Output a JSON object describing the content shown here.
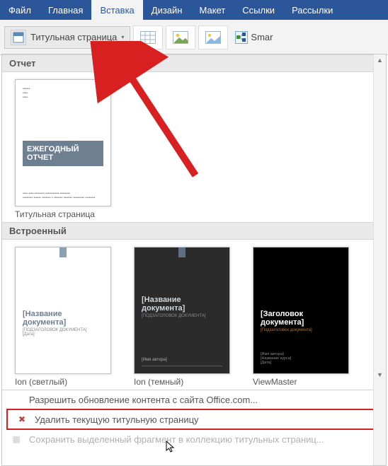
{
  "tabs": {
    "file": "Файл",
    "home": "Главная",
    "insert": "Вставка",
    "design": "Дизайн",
    "layout": "Макет",
    "references": "Ссылки",
    "mailings": "Рассылки"
  },
  "ribbon": {
    "title_page": "Титульная страница",
    "smart": "Smar"
  },
  "gallery": {
    "section_report": "Отчет",
    "report_item_label": "Титульная страница",
    "report_thumb": {
      "line1": "ЕЖЕГОДНЫЙ",
      "line2": "ОТЧЕТ",
      "sub": "ФГ [Год]"
    },
    "section_builtin": "Встроенный",
    "items": [
      {
        "label": "Ion (светлый)",
        "title": "[Название документа]",
        "style": "ion-light"
      },
      {
        "label": "Ion (темный)",
        "title": "[Название документа]",
        "style": "ion-dark"
      },
      {
        "label": "ViewMaster",
        "title": "[Заголовок документа]",
        "style": "vm"
      }
    ],
    "footer": {
      "allow_update": "Разрешить обновление контента с сайта Office.com...",
      "remove_current": "Удалить текущую титульную страницу",
      "save_selection": "Сохранить выделенный фрагмент в коллекцию титульных страниц..."
    }
  }
}
